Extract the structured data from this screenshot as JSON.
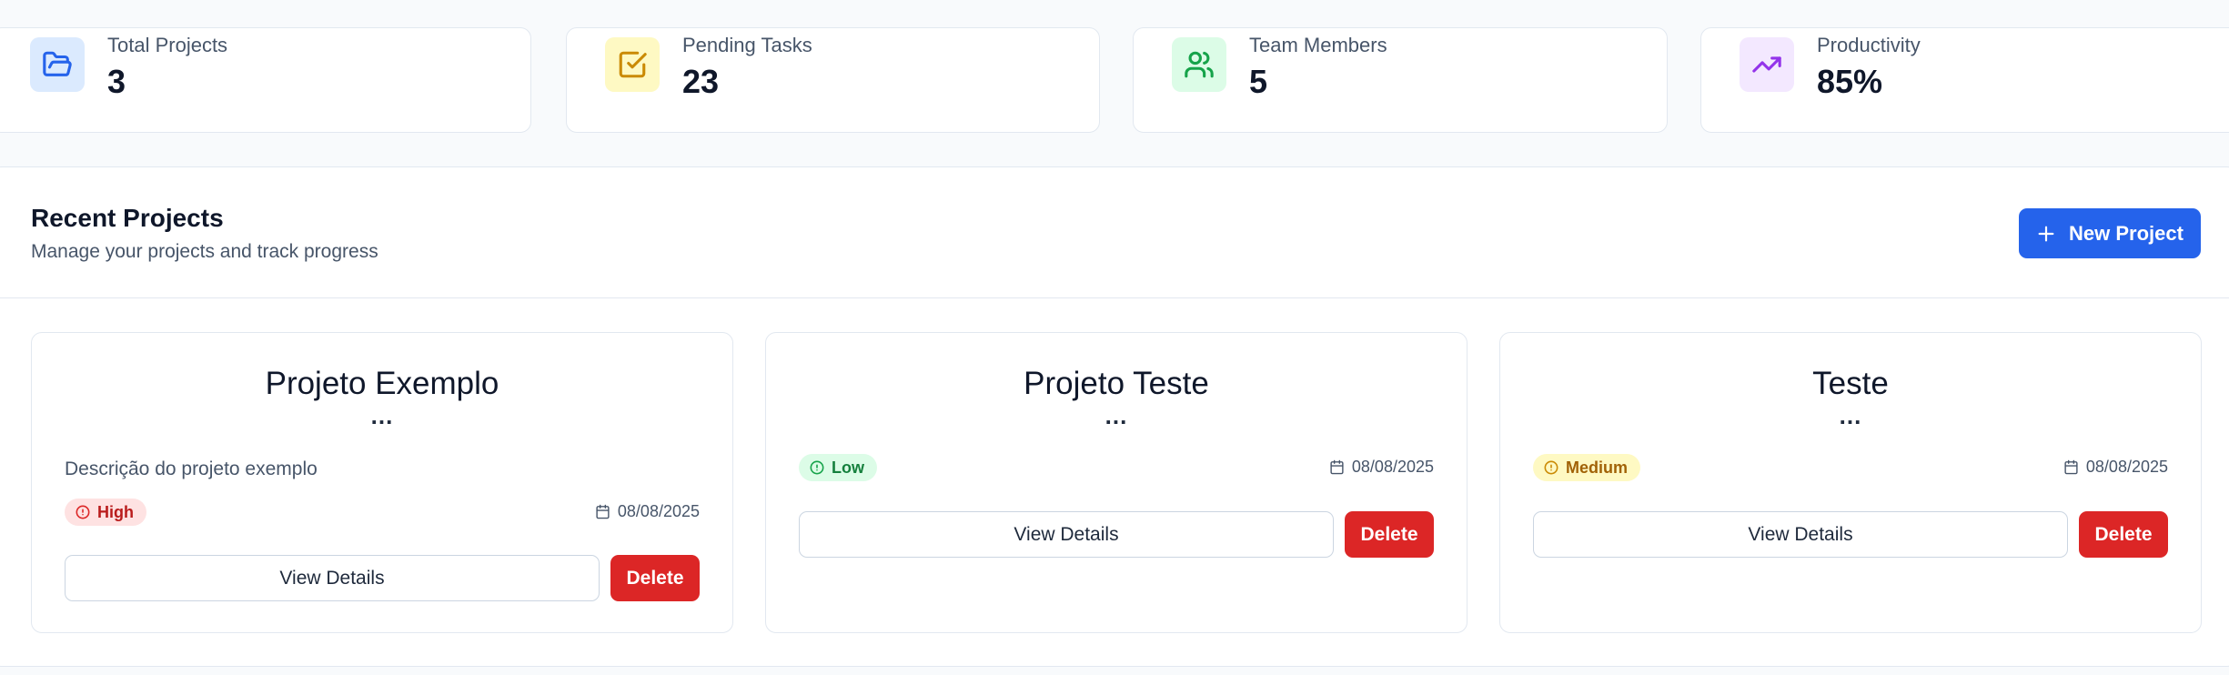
{
  "stats": [
    {
      "label": "Total Projects",
      "value": "3",
      "icon": "folder-open-icon",
      "bg": "#dbeafe",
      "color": "#2563eb"
    },
    {
      "label": "Pending Tasks",
      "value": "23",
      "icon": "check-square-icon",
      "bg": "#fef9c3",
      "color": "#ca8a04"
    },
    {
      "label": "Team Members",
      "value": "5",
      "icon": "users-icon",
      "bg": "#dcfce7",
      "color": "#16a34a"
    },
    {
      "label": "Productivity",
      "value": "85%",
      "icon": "trending-up-icon",
      "bg": "#f3e8ff",
      "color": "#9333ea"
    }
  ],
  "recent": {
    "title": "Recent Projects",
    "subtitle": "Manage your projects and track progress",
    "new_button_label": "New Project"
  },
  "projects": [
    {
      "title": "Projeto Exemplo",
      "dots": "...",
      "description": "Descrição do projeto exemplo",
      "priority": "High",
      "date": "08/08/2025",
      "view_label": "View Details",
      "delete_label": "Delete"
    },
    {
      "title": "Projeto Teste",
      "dots": "...",
      "description": "",
      "priority": "Low",
      "date": "08/08/2025",
      "view_label": "View Details",
      "delete_label": "Delete"
    },
    {
      "title": "Teste",
      "dots": "...",
      "description": "",
      "priority": "Medium",
      "date": "08/08/2025",
      "view_label": "View Details",
      "delete_label": "Delete"
    }
  ],
  "colors": {
    "primary": "#2563eb",
    "danger": "#dc2626"
  }
}
